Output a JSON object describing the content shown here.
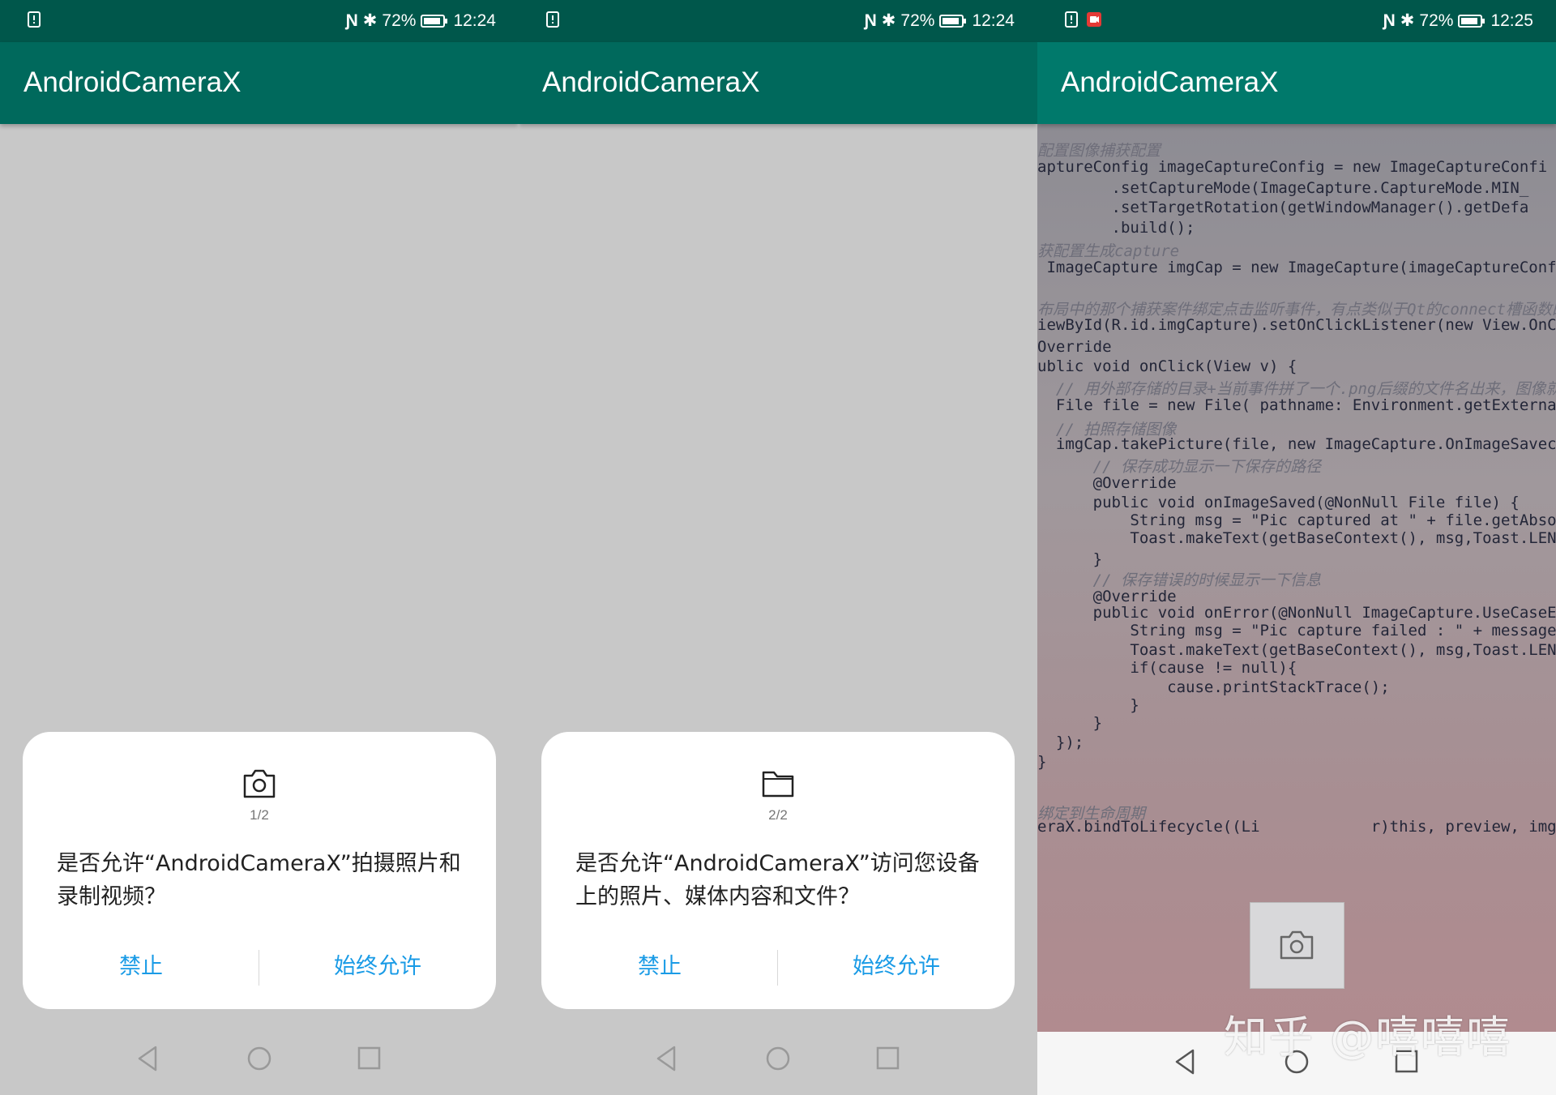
{
  "frames": [
    {
      "status": {
        "battery": "72%",
        "time": "12:24"
      },
      "app_title": "AndroidCameraX",
      "dialog": {
        "icon": "camera-icon",
        "step": "1/2",
        "message": "是否允许“AndroidCameraX”拍摄照片和录制视频？",
        "deny_label": "禁止",
        "allow_label": "始终允许"
      }
    },
    {
      "status": {
        "battery": "72%",
        "time": "12:24"
      },
      "app_title": "AndroidCameraX",
      "dialog": {
        "icon": "folder-icon",
        "step": "2/2",
        "message": "是否允许“AndroidCameraX”访问您设备上的照片、媒体内容和文件？",
        "deny_label": "禁止",
        "allow_label": "始终允许"
      }
    },
    {
      "status": {
        "battery": "72%",
        "time": "12:25"
      },
      "app_title": "AndroidCameraX",
      "code_lines": [
        "配置图像捕获配置",
        "aptureConfig imageCaptureConfig = new ImageCaptureConfi",
        "        .setCaptureMode(ImageCapture.CaptureMode.MIN_",
        "        .setTargetRotation(getWindowManager().getDefa",
        "        .build();",
        "获配置生成capture",
        " ImageCapture imgCap = new ImageCapture(imageCaptureConf",
        "布局中的那个捕获案件绑定点击监听事件，有点类似于Qt的connect槽函数的味",
        "iewById(R.id.imgCapture).setOnClickListener(new View.OnCl",
        "Override",
        "ublic void onClick(View v) {",
        "  // 用外部存储的目录+当前事件拼了一个.png后缀的文件名出来，图像就",
        "  File file = new File( pathname: Environment.getExternal",
        "  // 拍照存储图像",
        "  imgCap.takePicture(file, new ImageCapture.OnImageSavec",
        "      // 保存成功显示一下保存的路径",
        "      @Override",
        "      public void onImageSaved(@NonNull File file) {",
        "          String msg = \"Pic captured at \" + file.getAbso",
        "          Toast.makeText(getBaseContext(), msg,Toast.LEN",
        "      }",
        "      // 保存错误的时候显示一下信息",
        "      @Override",
        "      public void onError(@NonNull ImageCapture.UseCaseE",
        "          String msg = \"Pic capture failed : \" + message",
        "          Toast.makeText(getBaseContext(), msg,Toast.LEN",
        "          if(cause != null){",
        "              cause.printStackTrace();",
        "          }",
        "      }",
        "  });",
        "}",
        "绑定到生命周期",
        "eraX.bindToLifecycle((Li            r)this, preview, imgCap);"
      ],
      "watermark": "知乎 @嘻嘻嘻"
    }
  ]
}
